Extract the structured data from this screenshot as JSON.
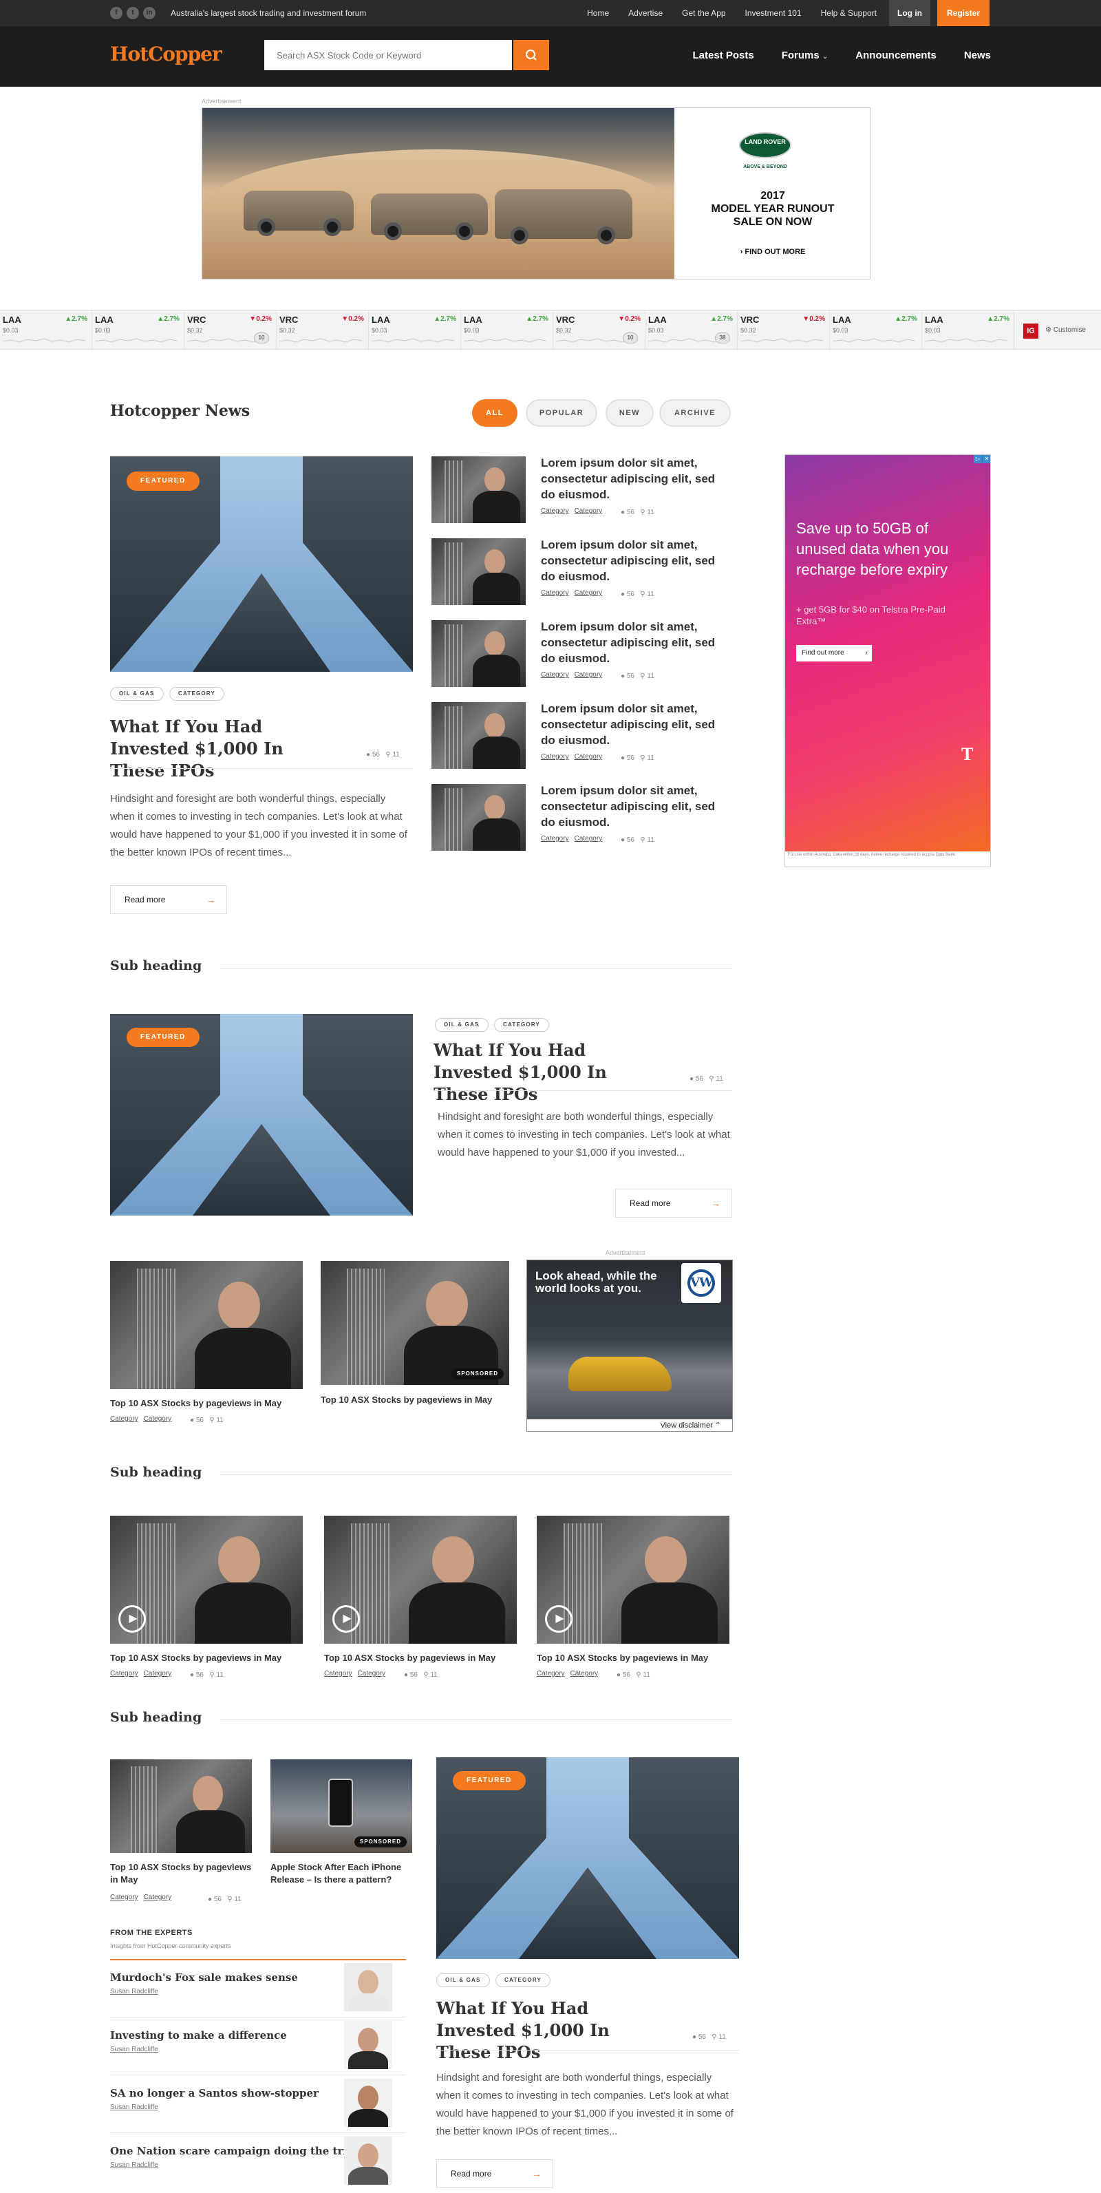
{
  "topbar": {
    "social": [
      "f",
      "t",
      "in"
    ],
    "tagline": "Australia's largest stock trading and investment forum",
    "links": [
      "Home",
      "Advertise",
      "Get the App",
      "Investment 101",
      "Help & Support"
    ],
    "login": "Log in",
    "register": "Register"
  },
  "header": {
    "logo": "HotCopper",
    "search_placeholder": "Search ASX Stock Code or Keyword",
    "nav": [
      "Latest Posts",
      "Forums",
      "Announcements",
      "News"
    ]
  },
  "ad_label": "Advertisement",
  "ad_top": {
    "badge": "LAND ROVER",
    "badge_sub": "ABOVE & BEYOND",
    "line1": "2017",
    "line2": "MODEL YEAR RUNOUT",
    "line3": "SALE ON NOW",
    "cta": "› FIND OUT MORE"
  },
  "ticker": {
    "items": [
      {
        "code": "LAA",
        "price": "$0.03",
        "change": "▲2.7%",
        "dir": "up"
      },
      {
        "code": "LAA",
        "price": "$0.03",
        "change": "▲2.7%",
        "dir": "up"
      },
      {
        "code": "VRC",
        "price": "$0.32",
        "change": "▼0.2%",
        "dir": "dn",
        "bubble": "10"
      },
      {
        "code": "VRC",
        "price": "$0.32",
        "change": "▼0.2%",
        "dir": "dn"
      },
      {
        "code": "LAA",
        "price": "$0.03",
        "change": "▲2.7%",
        "dir": "up"
      },
      {
        "code": "LAA",
        "price": "$0.03",
        "change": "▲2.7%",
        "dir": "up"
      },
      {
        "code": "VRC",
        "price": "$0.32",
        "change": "▼0.2%",
        "dir": "dn",
        "bubble": "10"
      },
      {
        "code": "LAA",
        "price": "$0.03",
        "change": "▲2.7%",
        "dir": "up",
        "bubble": "38"
      },
      {
        "code": "VRC",
        "price": "$0.32",
        "change": "▼0.2%",
        "dir": "dn"
      },
      {
        "code": "LAA",
        "price": "$0.03",
        "change": "▲2.7%",
        "dir": "up"
      },
      {
        "code": "LAA",
        "price": "$0.03",
        "change": "▲2.7%",
        "dir": "up"
      }
    ],
    "ig": "IG",
    "customise": "⚙ Customise"
  },
  "news": {
    "heading": "Hotcopper News",
    "filters": [
      "ALL",
      "POPULAR",
      "NEW",
      "ARCHIVE"
    ],
    "featured_tag": "FEATURED",
    "tags": [
      "OIL & GAS",
      "CATEGORY"
    ],
    "title": "What If You Had Invested $1,000 In These IPOs",
    "comments": "56",
    "likes": "11",
    "excerpt": "Hindsight and foresight are both wonderful things, especially when it comes to investing in tech companies. Let's look at what would have happened to your $1,000 if you invested it in some of the better known IPOs of recent times...",
    "excerpt_short": "Hindsight and foresight are both wonderful things, especially when it comes to investing in tech companies. Let's look at what would have happened to your $1,000 if you invested...",
    "read_more": "Read more",
    "list_title": "Lorem ipsum dolor sit amet, consectetur adipiscing elit, sed do eiusmod.",
    "category": "Category"
  },
  "tel_ad": {
    "headline": "Save up to 50GB of unused data when you recharge before expiry",
    "sub": "+ get 5GB for $40 on Telstra Pre-Paid Extra™",
    "button": "Find out more",
    "logo": "T",
    "foot": "For use within Australia. Data within 28 days. Active recharge required to access Data Bank."
  },
  "sub_heading": "Sub heading",
  "card_title": "Top 10 ASX Stocks by pageviews in May",
  "sponsored": "SPONSORED",
  "iphone_title": "Apple Stock After Each iPhone Release – Is there a pattern?",
  "vw_ad": {
    "headline": "Look ahead, while the world looks at you.",
    "logo": "VW",
    "disclaimer": "View disclaimer ⌃"
  },
  "experts": {
    "heading": "FROM THE EXPERTS",
    "sub": "Insights from HotCopper community experts",
    "items": [
      {
        "title": "Murdoch's Fox sale makes sense",
        "author": "Susan Radcliffe"
      },
      {
        "title": "Investing to make a difference",
        "author": "Susan Radcliffe"
      },
      {
        "title": "SA no longer a Santos show-stopper",
        "author": "Susan Radcliffe"
      },
      {
        "title": "One Nation scare campaign doing the trick",
        "author": "Susan Radcliffe"
      }
    ]
  }
}
